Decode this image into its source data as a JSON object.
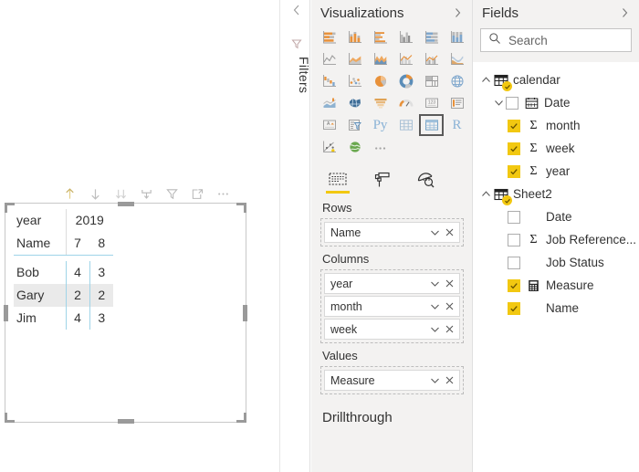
{
  "canvas": {
    "visual_header_icons": [
      {
        "name": "drill-up-icon",
        "title": "Drill Up",
        "active": true
      },
      {
        "name": "drill-down-icon",
        "title": "Drill Down",
        "active": false
      },
      {
        "name": "expand-all-down-icon",
        "title": "Expand all down one level",
        "active": false
      },
      {
        "name": "go-to-next-level-icon",
        "title": "Go to the next level",
        "active": false
      },
      {
        "name": "filter-icon",
        "title": "Filters",
        "active": false
      },
      {
        "name": "focus-mode-icon",
        "title": "Focus mode",
        "active": false
      },
      {
        "name": "more-options-icon",
        "title": "More options",
        "active": false
      }
    ],
    "matrix": {
      "corner_row_label": "year",
      "corner_col_label": "Name",
      "col_group_header": "2019",
      "col_headers": [
        "7",
        "8"
      ],
      "row_headers": [
        "Bob",
        "Gary",
        "Jim"
      ],
      "values": [
        [
          "4",
          "3"
        ],
        [
          "2",
          "2"
        ],
        [
          "4",
          "3"
        ]
      ],
      "selected_row_index": 1
    }
  },
  "filters": {
    "label": "Filters",
    "collapse_chevron": "‹",
    "funnel_icon": "filter-funnel-icon"
  },
  "visualizations": {
    "title": "Visualizations",
    "expand_chevron": "›",
    "gallery": [
      {
        "name": "stacked-bar-chart-icon"
      },
      {
        "name": "stacked-column-chart-icon"
      },
      {
        "name": "clustered-bar-chart-icon"
      },
      {
        "name": "clustered-column-chart-icon"
      },
      {
        "name": "100-percent-stacked-bar-chart-icon"
      },
      {
        "name": "100-percent-stacked-column-chart-icon"
      },
      {
        "name": "line-chart-icon"
      },
      {
        "name": "area-chart-icon"
      },
      {
        "name": "stacked-area-chart-icon"
      },
      {
        "name": "line-and-stacked-column-chart-icon"
      },
      {
        "name": "line-and-clustered-column-chart-icon"
      },
      {
        "name": "ribbon-chart-icon"
      },
      {
        "name": "waterfall-chart-icon"
      },
      {
        "name": "scatter-chart-icon"
      },
      {
        "name": "pie-chart-icon"
      },
      {
        "name": "donut-chart-icon"
      },
      {
        "name": "treemap-icon"
      },
      {
        "name": "map-icon"
      },
      {
        "name": "filled-map-icon"
      },
      {
        "name": "shape-map-icon"
      },
      {
        "name": "funnel-chart-icon"
      },
      {
        "name": "gauge-chart-icon"
      },
      {
        "name": "card-icon"
      },
      {
        "name": "multi-row-card-icon"
      },
      {
        "name": "kpi-icon"
      },
      {
        "name": "slicer-icon"
      },
      {
        "name": "python-visual-icon",
        "glyph": "Py"
      },
      {
        "name": "table-icon"
      },
      {
        "name": "matrix-icon",
        "selected": true
      },
      {
        "name": "r-script-visual-icon",
        "glyph": "R"
      },
      {
        "name": "key-influencers-icon"
      },
      {
        "name": "arcgis-map-icon"
      },
      {
        "name": "more-visuals-icon",
        "glyph": "…"
      }
    ],
    "tabs": [
      {
        "name": "fields-tab",
        "label": "Fields",
        "selected": true
      },
      {
        "name": "format-tab",
        "label": "Format",
        "selected": false
      },
      {
        "name": "analytics-tab",
        "label": "Analytics",
        "selected": false
      }
    ],
    "wells": [
      {
        "name": "rows-well",
        "label": "Rows",
        "chips": [
          {
            "label": "Name"
          }
        ]
      },
      {
        "name": "columns-well",
        "label": "Columns",
        "chips": [
          {
            "label": "year"
          },
          {
            "label": "month"
          },
          {
            "label": "week"
          }
        ]
      },
      {
        "name": "values-well",
        "label": "Values",
        "chips": [
          {
            "label": "Measure"
          }
        ]
      }
    ],
    "drillthrough_label": "Drillthrough",
    "chip_caret": "∨",
    "chip_close": "✕"
  },
  "fields": {
    "title": "Fields",
    "expand_chevron": "›",
    "search": {
      "placeholder": "Search",
      "value": "Search",
      "icon": "search-icon"
    },
    "tree": [
      {
        "name": "table-calendar",
        "label": "calendar",
        "level": 0,
        "type": "table",
        "expanded": true,
        "checked": false,
        "icon": "table-icon"
      },
      {
        "name": "field-calendar-date",
        "label": "Date",
        "level": 1,
        "type": "hierarchy",
        "expanded": true,
        "checked": false,
        "icon": "calendar-icon"
      },
      {
        "name": "field-calendar-month",
        "label": "month",
        "level": 2,
        "type": "measure-sum",
        "checked": true,
        "icon": "sigma-icon"
      },
      {
        "name": "field-calendar-week",
        "label": "week",
        "level": 2,
        "type": "measure-sum",
        "checked": true,
        "icon": "sigma-icon"
      },
      {
        "name": "field-calendar-year",
        "label": "year",
        "level": 2,
        "type": "measure-sum",
        "checked": true,
        "icon": "sigma-icon"
      },
      {
        "name": "table-sheet2",
        "label": "Sheet2",
        "level": 0,
        "type": "table",
        "expanded": true,
        "checked": false,
        "icon": "table-icon"
      },
      {
        "name": "field-sheet2-date",
        "label": "Date",
        "level": 2,
        "type": "column",
        "checked": false,
        "icon": "none"
      },
      {
        "name": "field-sheet2-job-reference",
        "label": "Job Reference...",
        "level": 2,
        "type": "measure-sum",
        "checked": false,
        "icon": "sigma-icon"
      },
      {
        "name": "field-sheet2-job-status",
        "label": "Job Status",
        "level": 2,
        "type": "column",
        "checked": false,
        "icon": "none"
      },
      {
        "name": "field-sheet2-measure",
        "label": "Measure",
        "level": 2,
        "type": "measure",
        "checked": true,
        "icon": "calculator-icon"
      },
      {
        "name": "field-sheet2-name",
        "label": "Name",
        "level": 2,
        "type": "column",
        "checked": true,
        "icon": "none"
      }
    ]
  },
  "colors": {
    "accent_yellow": "#f2c811",
    "pane_bg": "#f3f2f1",
    "matrix_grid_blue": "#9fd4e8",
    "selected_row_bg": "#eaeaea",
    "icon_orange": "#e8913a",
    "icon_blue": "#7ea6cc",
    "icon_gray": "#9a9a9a"
  }
}
